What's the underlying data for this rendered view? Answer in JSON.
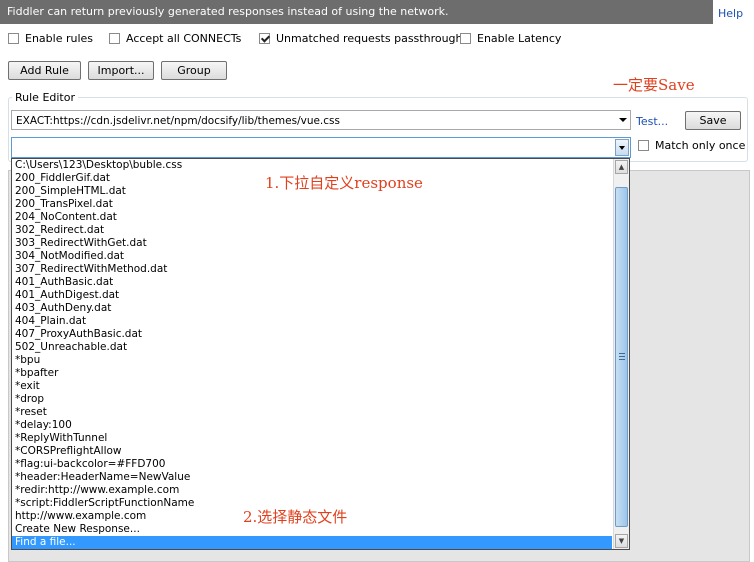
{
  "infobar": {
    "text": "Fiddler can return previously generated responses instead of using the network."
  },
  "help": "Help",
  "options": {
    "enable_rules": "Enable rules",
    "accept_connects": "Accept all CONNECTs",
    "unmatched_passthrough": "Unmatched requests passthrough",
    "enable_latency": "Enable Latency",
    "unmatched_checked": true
  },
  "toolbar": {
    "add_rule": "Add Rule",
    "import": "Import...",
    "group": "Group"
  },
  "rule_editor": {
    "legend": "Rule Editor",
    "match_value": "EXACT:https://cdn.jsdelivr.net/npm/docsify/lib/themes/vue.css",
    "response_value": "",
    "test_link": "Test...",
    "save": "Save",
    "match_only_once": "Match only once"
  },
  "response_list": [
    "C:\\Users\\123\\Desktop\\buble.css",
    "200_FiddlerGif.dat",
    "200_SimpleHTML.dat",
    "200_TransPixel.dat",
    "204_NoContent.dat",
    "302_Redirect.dat",
    "303_RedirectWithGet.dat",
    "304_NotModified.dat",
    "307_RedirectWithMethod.dat",
    "401_AuthBasic.dat",
    "401_AuthDigest.dat",
    "403_AuthDeny.dat",
    "404_Plain.dat",
    "407_ProxyAuthBasic.dat",
    "502_Unreachable.dat",
    "*bpu",
    "*bpafter",
    "*exit",
    "*drop",
    "*reset",
    "*delay:100",
    "*ReplyWithTunnel",
    "*CORSPreflightAllow",
    "*flag:ui-backcolor=#FFD700",
    "*header:HeaderName=NewValue",
    "*redir:http://www.example.com",
    "*script:FiddlerScriptFunctionName",
    "http://www.example.com",
    "Create New Response...",
    "Find a file..."
  ],
  "selected_index": 29,
  "annotations": {
    "save_note": "一定要Save",
    "dropdown_note": "1.下拉自定义response",
    "static_note": "2.选择静态文件"
  },
  "colors": {
    "annotation": "#e1401e",
    "selection": "#3399ff",
    "infobar": "#6d6d6d",
    "link": "#1a4fb5"
  }
}
